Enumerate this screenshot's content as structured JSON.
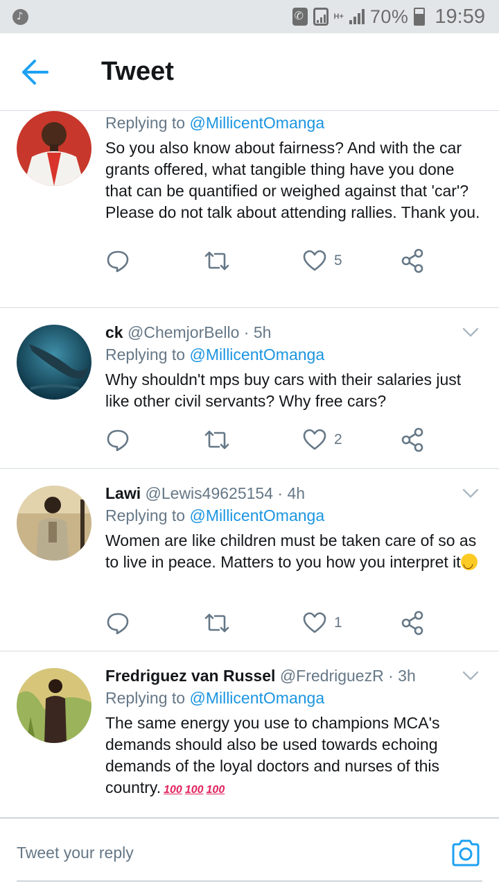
{
  "status_bar": {
    "battery_percent": "70%",
    "time": "19:59",
    "network_type": "H+"
  },
  "header": {
    "back_icon": "arrow-left-icon",
    "title": "Tweet"
  },
  "colors": {
    "accent": "#1b95e0",
    "text": "#14171a",
    "secondary": "#657786",
    "divider": "#d6dbe0"
  },
  "tweets": [
    {
      "name": "",
      "handle": "",
      "time": "",
      "replying_prefix": "Replying to",
      "replying_to": "@MillicentOmanga",
      "text": "So you also know about fairness? And with the car grants offered, what tangible thing have you done that can be quantified or weighed against that 'car'? Please do not talk about attending rallies. Thank you.",
      "likes": "5"
    },
    {
      "name": "ck",
      "handle": "@ChemjorBello",
      "time": "· 5h",
      "replying_prefix": "Replying to",
      "replying_to": "@MillicentOmanga",
      "text": "Why shouldn't mps buy cars with their salaries just like other civil servants? Why free cars?",
      "likes": "2"
    },
    {
      "name": "Lawi",
      "handle": "@Lewis49625154",
      "time": "· 4h",
      "replying_prefix": "Replying to",
      "replying_to": "@MillicentOmanga",
      "text": "Women are like children must be taken care of so as to live in peace. Matters to you how you interpret it",
      "likes": "1"
    },
    {
      "name": "Fredriguez van Russel",
      "handle": "@FredriguezR",
      "time": "· 3h",
      "replying_prefix": "Replying to",
      "replying_to": "@MillicentOmanga",
      "text": "The same energy you use to champions MCA's demands should also be used towards echoing demands of  the loyal doctors and nurses of this country.",
      "likes": ""
    }
  ],
  "emoji": {
    "hundred": "100"
  },
  "composer": {
    "placeholder": "Tweet your reply",
    "camera_icon": "camera-icon"
  }
}
